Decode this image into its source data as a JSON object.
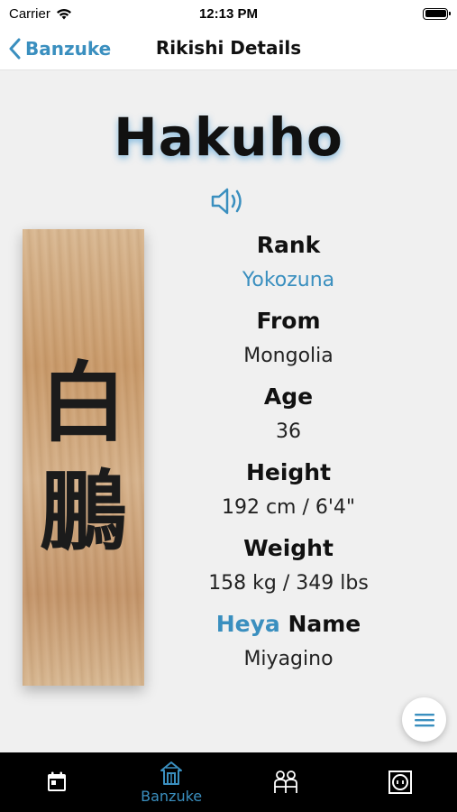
{
  "status_bar": {
    "carrier": "Carrier",
    "time": "12:13 PM"
  },
  "nav": {
    "back_label": "Banzuke",
    "title": "Rikishi Details"
  },
  "rikishi": {
    "name": "Hakuho",
    "nameplate_kanji_1": "白",
    "nameplate_kanji_2": "鵬"
  },
  "details": {
    "rank_label": "Rank",
    "rank_value": "Yokozuna",
    "from_label": "From",
    "from_value": "Mongolia",
    "age_label": "Age",
    "age_value": "36",
    "height_label": "Height",
    "height_value": "192 cm / 6'4\"",
    "weight_label": "Weight",
    "weight_value": "158 kg / 349 lbs",
    "heya_label_link": "Heya",
    "heya_label_rest": "Name",
    "heya_value": "Miyagino"
  },
  "tabs": [
    {
      "icon": "calendar-icon",
      "label": ""
    },
    {
      "icon": "banzuke-house-icon",
      "label": "Banzuke"
    },
    {
      "icon": "wrestlers-icon",
      "label": ""
    },
    {
      "icon": "dohyo-icon",
      "label": ""
    }
  ],
  "colors": {
    "accent": "#3a8fbf",
    "tab_bar": "#000000",
    "background": "#f0f0f0"
  },
  "icons": {
    "wifi": "wifi-icon",
    "battery": "battery-icon",
    "back": "chevron-left-icon",
    "speaker": "speaker-icon",
    "menu": "menu-icon"
  }
}
